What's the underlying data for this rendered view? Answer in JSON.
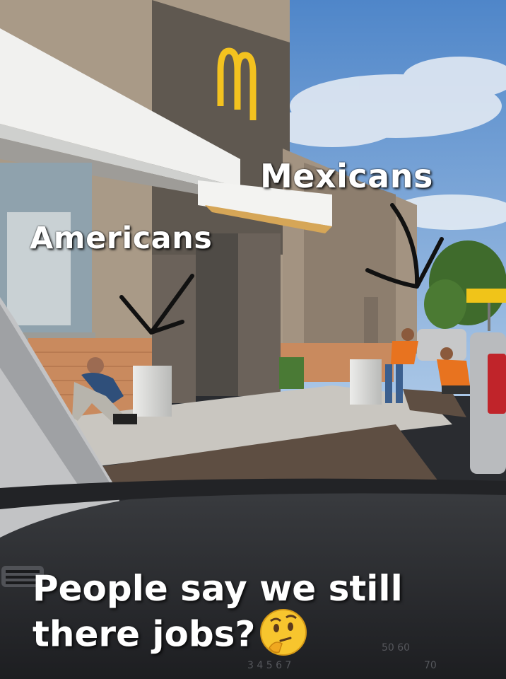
{
  "labels": {
    "mexicans": "Mexicans",
    "americans": "Americans"
  },
  "caption": {
    "line1": "People say we still",
    "line2": "there jobs?"
  },
  "emoji": "thinking-face-emoji",
  "colors": {
    "sky": "#6f9bd0",
    "building_dark": "#6b625a",
    "brick": "#c98a5e",
    "arches": "#f3c21f",
    "vest": "#e8731f",
    "dashboard": "#2a2c30"
  }
}
